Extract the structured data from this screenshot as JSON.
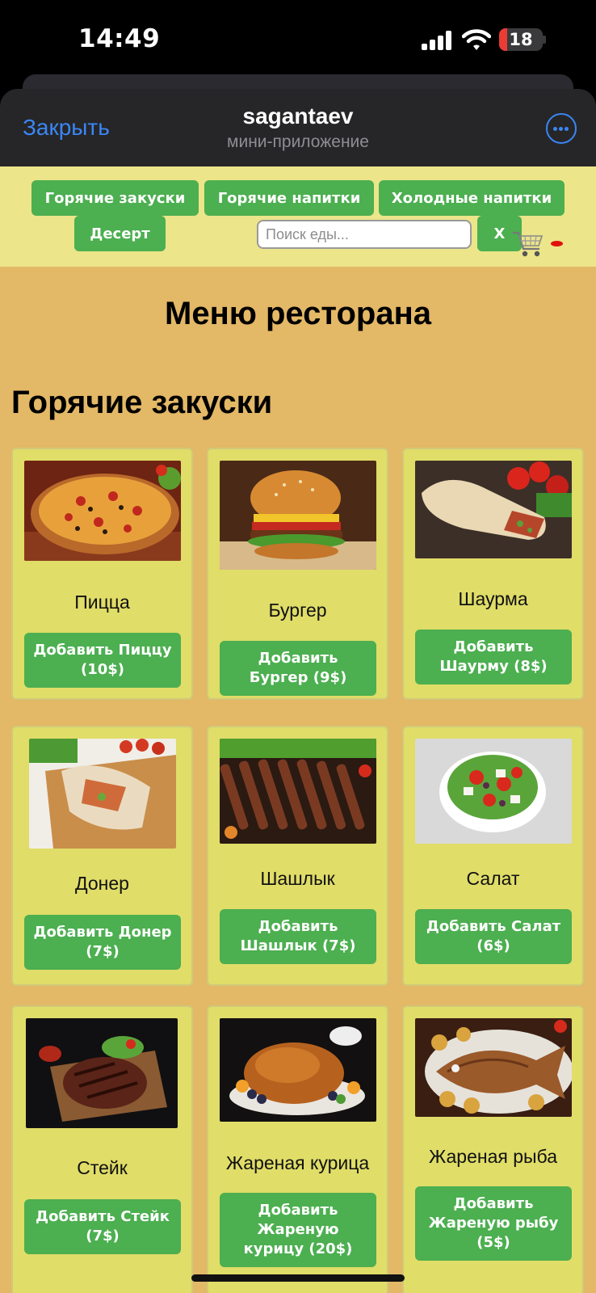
{
  "status_bar": {
    "time": "14:49",
    "battery": "18",
    "battery_level": 0.18
  },
  "header": {
    "close_label": "Закрыть",
    "title": "sagantaev",
    "subtitle": "мини-приложение"
  },
  "nav": {
    "categories": [
      "Горячие закуски",
      "Горячие напитки",
      "Холодные напитки",
      "Десерт"
    ],
    "search_placeholder": "Поиск еды...",
    "clear_label": "X"
  },
  "page": {
    "title": "Меню ресторана",
    "section_title": "Горячие закуски"
  },
  "items": [
    {
      "name": "Пицца",
      "button": "Добавить Пиццу (10$)"
    },
    {
      "name": "Бургер",
      "button": "Добавить Бургер (9$)"
    },
    {
      "name": "Шаурма",
      "button": "Добавить Шаурму (8$)"
    },
    {
      "name": "Донер",
      "button": "Добавить Донер (7$)"
    },
    {
      "name": "Шашлык",
      "button": "Добавить Шашлык (7$)"
    },
    {
      "name": "Салат",
      "button": "Добавить Салат (6$)"
    },
    {
      "name": "Стейк",
      "button": "Добавить Стейк (7$)"
    },
    {
      "name": "Жареная курица",
      "button": "Добавить Жареную курицу (20$)"
    },
    {
      "name": "Жареная рыба",
      "button": "Добавить Жареную рыбу (5$)"
    }
  ],
  "colors": {
    "accent_green": "#4caf50",
    "link_blue": "#3a86f5",
    "page_bg": "#e3b866",
    "nav_bg": "#ece58a",
    "card_bg": "#e0dd68"
  }
}
